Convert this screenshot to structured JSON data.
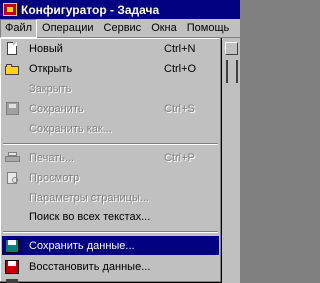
{
  "window": {
    "title": "Конфигуратор - Задача"
  },
  "menubar": [
    {
      "label": "Файл",
      "active": true
    },
    {
      "label": "Операции"
    },
    {
      "label": "Сервис"
    },
    {
      "label": "Окна"
    },
    {
      "label": "Помощь"
    }
  ],
  "file_menu": {
    "new": {
      "label": "Новый",
      "shortcut": "Ctrl+N",
      "icon": "new-document-icon"
    },
    "open": {
      "label": "Открыть",
      "shortcut": "Ctrl+O",
      "icon": "open-folder-icon"
    },
    "close": {
      "label": "Закрыть"
    },
    "save": {
      "label": "Сохранить",
      "shortcut": "Ctrl+S",
      "icon": "save-disk-icon"
    },
    "save_as": {
      "label": "Сохранить как..."
    },
    "print": {
      "label": "Печать...",
      "shortcut": "Ctrl+P",
      "icon": "printer-icon"
    },
    "preview": {
      "label": "Просмотр",
      "icon": "print-preview-icon"
    },
    "page_setup": {
      "label": "Параметры страницы..."
    },
    "search_all": {
      "label": "Поиск во всех текстах..."
    },
    "save_data": {
      "label": "Сохранить данные...",
      "icon": "save-data-icon"
    },
    "restore_data": {
      "label": "Восстановить данные...",
      "icon": "restore-data-icon"
    }
  }
}
